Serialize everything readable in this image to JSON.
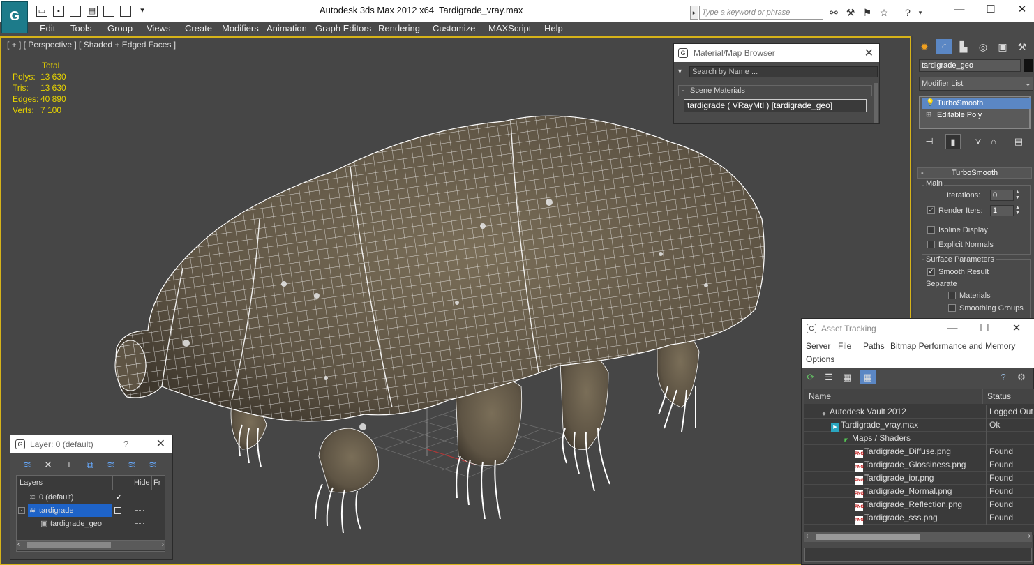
{
  "window": {
    "title": "Autodesk 3ds Max  2012 x64",
    "filename": "Tardigrade_vray.max",
    "logo": "G"
  },
  "search": {
    "placeholder": "Type a keyword or phrase"
  },
  "menu": [
    "Edit",
    "Tools",
    "Group",
    "Views",
    "Create",
    "Modifiers",
    "Animation",
    "Graph Editors",
    "Rendering",
    "Customize",
    "MAXScript",
    "Help"
  ],
  "viewport": {
    "label": "[ + ] [ Perspective ] [ Shaded + Edged Faces ]",
    "stats": {
      "header": "Total",
      "polys_label": "Polys:",
      "polys": "13 630",
      "tris_label": "Tris:",
      "tris": "13 630",
      "edges_label": "Edges:",
      "edges": "40 890",
      "verts_label": "Verts:",
      "verts": "7 100"
    }
  },
  "command_panel": {
    "object_name": "tardigrade_geo",
    "modifier_list": "Modifier List",
    "stack": [
      "TurboSmooth",
      "Editable Poly"
    ],
    "rollout_title": "TurboSmooth",
    "main_group": "Main",
    "iterations_label": "Iterations:",
    "iterations": "0",
    "render_iters_label": "Render Iters:",
    "render_iters": "1",
    "isoline_label": "Isoline Display",
    "explicit_normals_label": "Explicit Normals",
    "surface_group": "Surface Parameters",
    "smooth_result_label": "Smooth Result",
    "separate_label": "Separate",
    "materials_label": "Materials",
    "smoothing_groups_label": "Smoothing Groups"
  },
  "material_browser": {
    "title": "Material/Map Browser",
    "search_placeholder": "Search by Name ...",
    "section": "Scene Materials",
    "item": "tardigrade  ( VRayMtl ) [tardigrade_geo]"
  },
  "layer_dialog": {
    "title": "Layer: 0 (default)",
    "help": "?",
    "columns": [
      "Layers",
      "Hide",
      "Fr"
    ],
    "rows": [
      {
        "name": "0 (default)",
        "check": "✓"
      },
      {
        "name": "tardigrade"
      },
      {
        "name": "tardigrade_geo"
      }
    ]
  },
  "asset_tracking": {
    "title": "Asset Tracking",
    "menu": [
      "Server",
      "File",
      "Paths",
      "Bitmap Performance and Memory",
      "Options"
    ],
    "columns": [
      "Name",
      "Status"
    ],
    "rows": [
      {
        "name": "Autodesk Vault 2012",
        "status": "Logged Out"
      },
      {
        "name": "Tardigrade_vray.max",
        "status": "Ok"
      },
      {
        "name": "Maps / Shaders",
        "status": ""
      },
      {
        "name": "Tardigrade_Diffuse.png",
        "status": "Found"
      },
      {
        "name": "Tardigrade_Glossiness.png",
        "status": "Found"
      },
      {
        "name": "Tardigrade_ior.png",
        "status": "Found"
      },
      {
        "name": "Tardigrade_Normal.png",
        "status": "Found"
      },
      {
        "name": "Tardigrade_Reflection.png",
        "status": "Found"
      },
      {
        "name": "Tardigrade_sss.png",
        "status": "Found"
      }
    ]
  },
  "colors": {
    "viewport_border": "#d6b319",
    "stats": "#e6d200",
    "selection": "#5b87c4"
  }
}
